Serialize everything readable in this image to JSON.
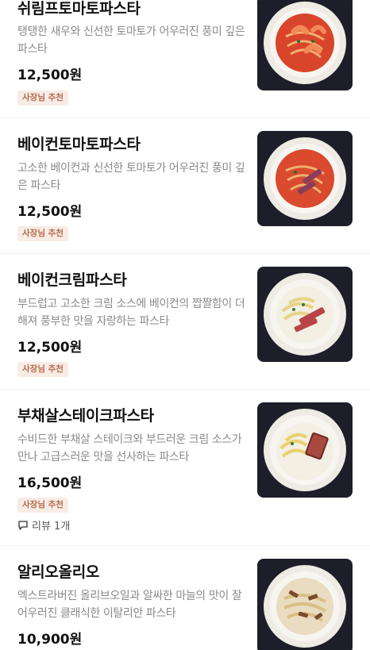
{
  "items": [
    {
      "name": "쉬림프토마토파스타",
      "description": "탱탱한 새우와 신선한 토마토가 어우러진 풍미 깊은 파스타",
      "price": "12,500원",
      "badge": "사장님 추천",
      "image_icon": "shrimp-tomato-pasta-photo"
    },
    {
      "name": "베이컨토마토파스타",
      "description": "고소한 베이컨과 신선한 토마토가 어우러진 풍미 깊은 파스타",
      "price": "12,500원",
      "badge": "사장님 추천",
      "image_icon": "bacon-tomato-pasta-photo"
    },
    {
      "name": "베이컨크림파스타",
      "description": "부드럽고 고소한 크림 소스에 베이컨의 짭짤함이 더해져 풍부한 맛을 자랑하는 파스타",
      "price": "12,500원",
      "badge": "사장님 추천",
      "image_icon": "bacon-cream-pasta-photo"
    },
    {
      "name": "부채살스테이크파스타",
      "description": "수비드한 부채살 스테이크와 부드러운 크림 소스가 만나 고급스러운 맛을 선사하는 파스타",
      "price": "16,500원",
      "badge": "사장님 추천",
      "review": "리뷰 1개",
      "image_icon": "steak-pasta-photo"
    },
    {
      "name": "알리오올리오",
      "description": "엑스트라버진 올리브오일과 알싸한 마늘의 맛이 잘 어우러진 클래식한 이탈리안 파스타",
      "price": "10,900원",
      "image_icon": "aglio-olio-photo"
    }
  ],
  "colors": {
    "badge_bg": "#f7ece6",
    "badge_text": "#b8694a",
    "description": "#8a8a8a",
    "photo_bg": "#1e1e2a"
  }
}
